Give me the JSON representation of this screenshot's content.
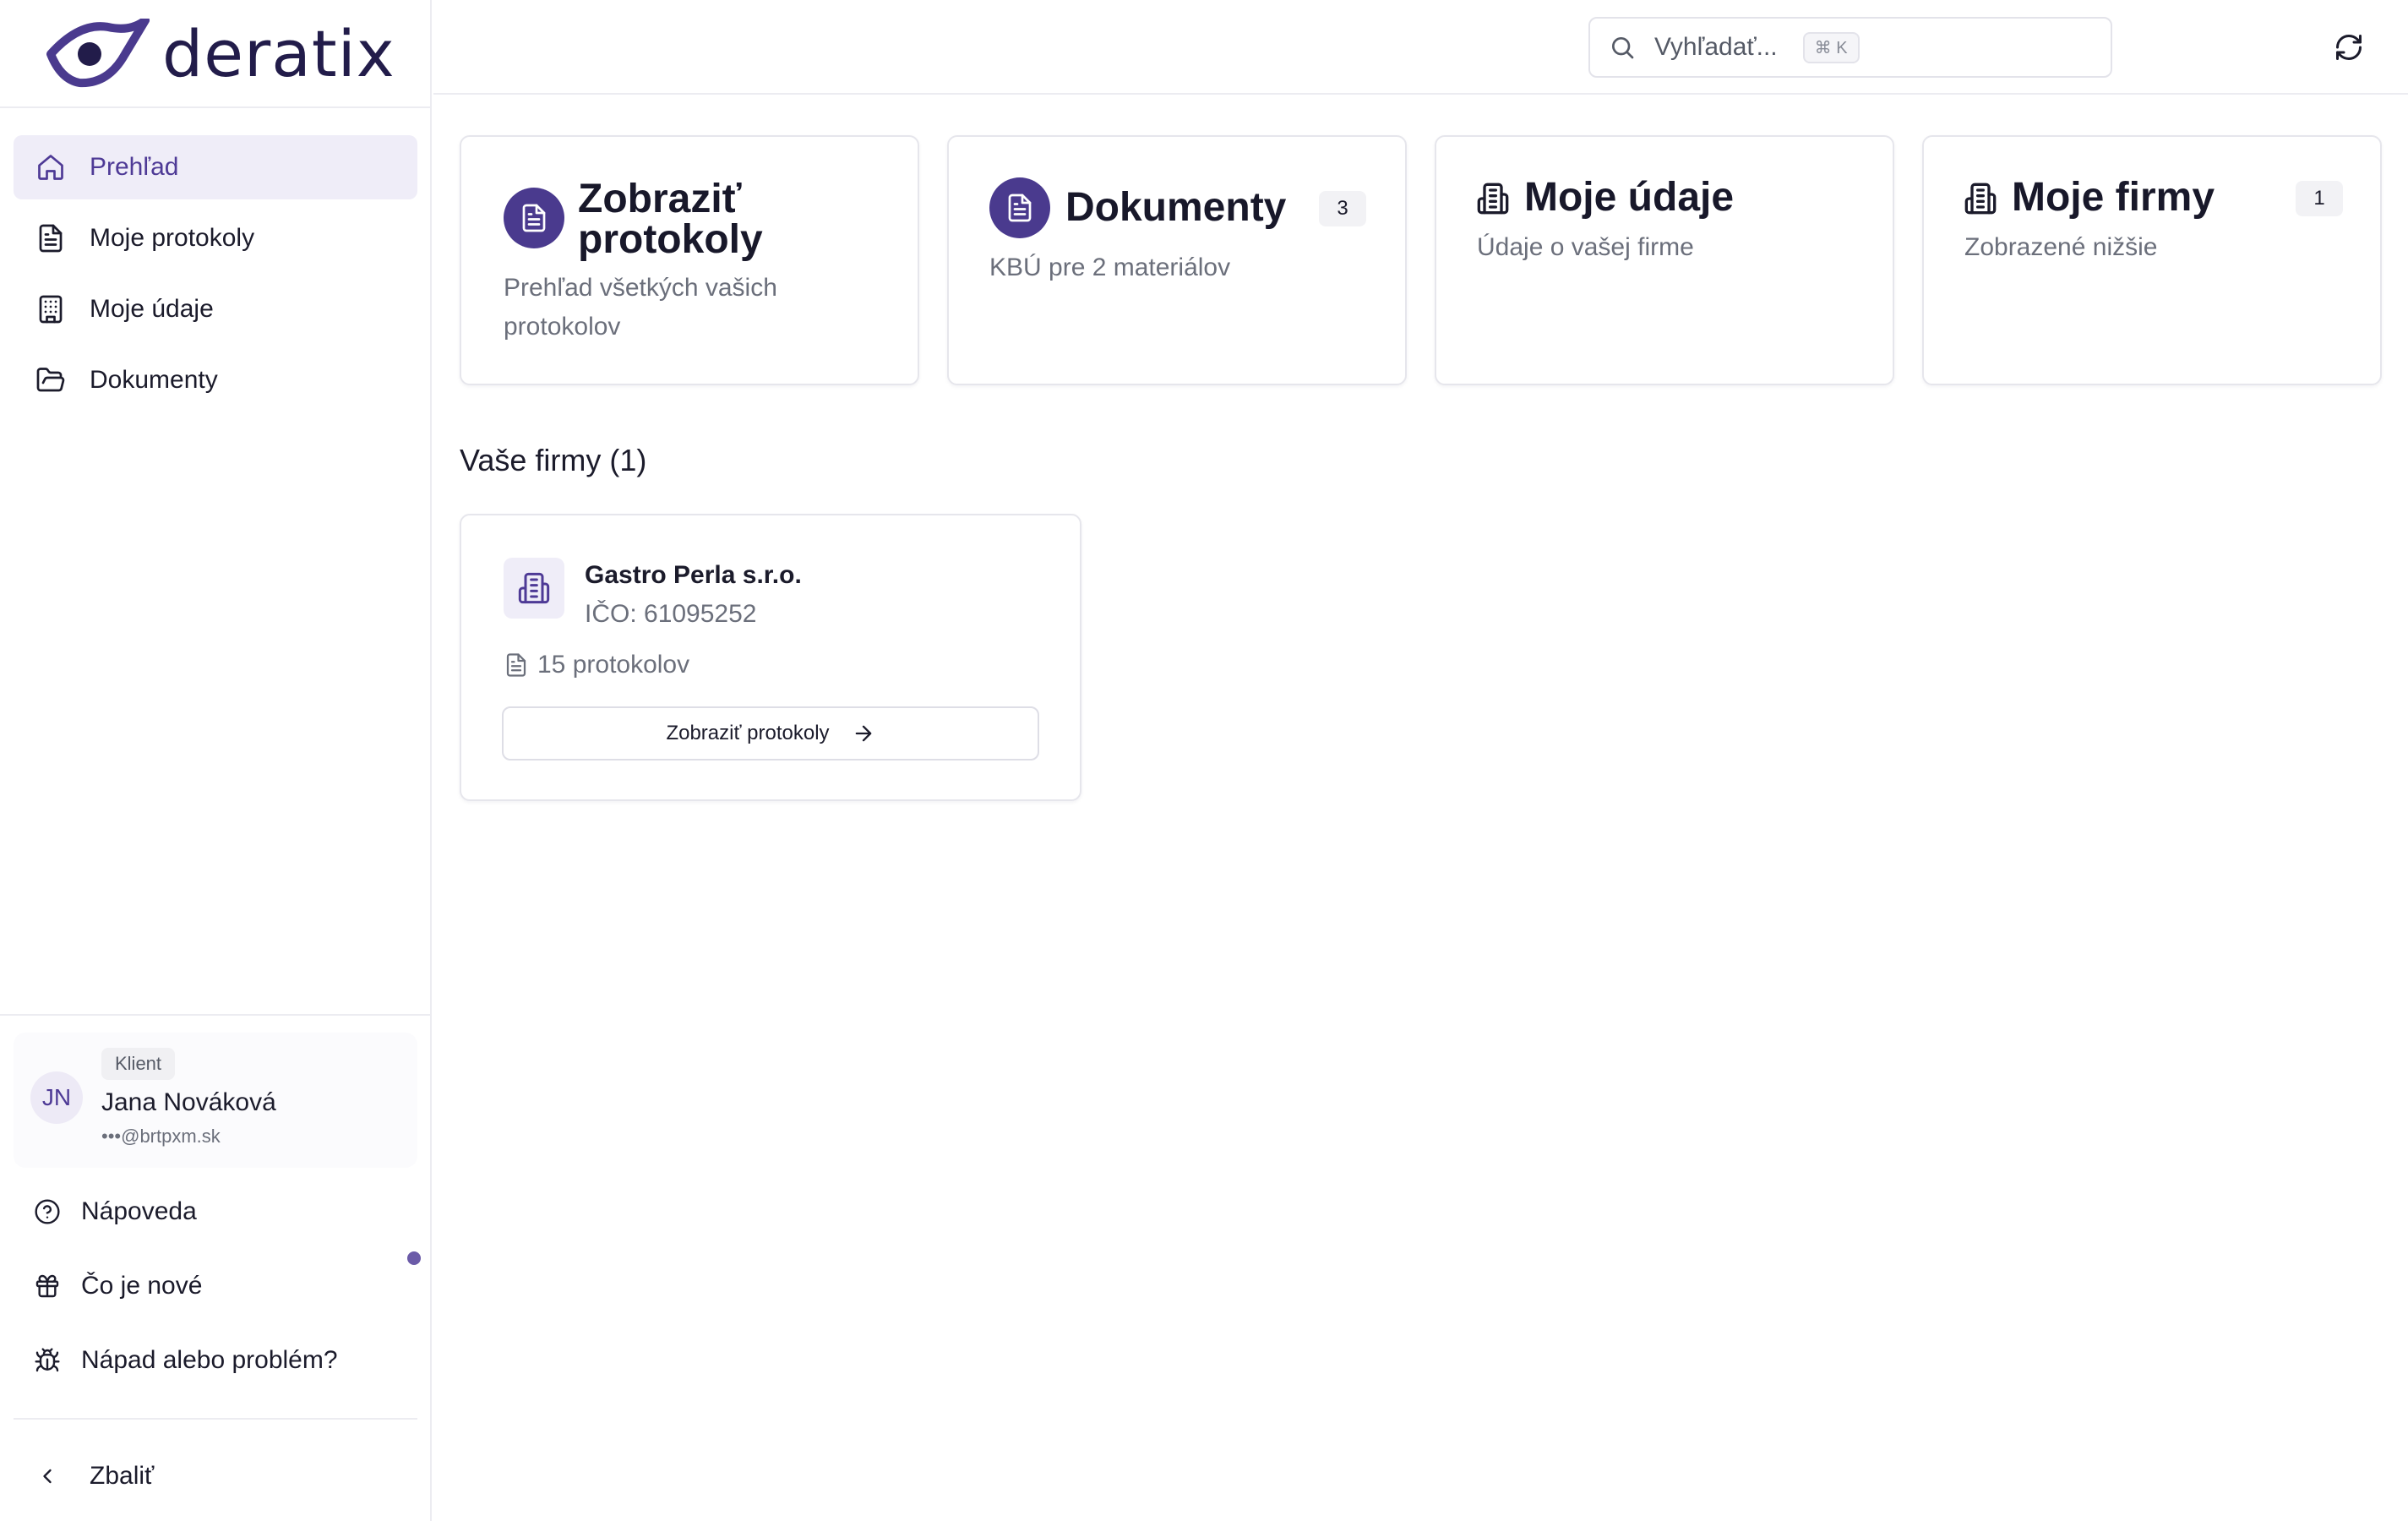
{
  "brand": {
    "name": "deratix",
    "color": "#221c4a",
    "accent": "#4a3a8e"
  },
  "sidebar": {
    "items": [
      {
        "label": "Prehľad",
        "icon": "home-icon",
        "active": true
      },
      {
        "label": "Moje protokoly",
        "icon": "file-text-icon",
        "active": false
      },
      {
        "label": "Moje údaje",
        "icon": "building-icon",
        "active": false
      },
      {
        "label": "Dokumenty",
        "icon": "folder-open-icon",
        "active": false
      }
    ],
    "user": {
      "role": "Klient",
      "initials": "JN",
      "name": "Jana Nováková",
      "email": "•••@brtpxm.sk"
    },
    "utilities": [
      {
        "label": "Nápoveda",
        "icon": "help-circle-icon"
      },
      {
        "label": "Čo je nové",
        "icon": "gift-icon"
      },
      {
        "label": "Nápad alebo problém?",
        "icon": "bug-icon"
      }
    ],
    "collapse_label": "Zbaliť"
  },
  "topbar": {
    "search_placeholder": "Vyhľadať...",
    "shortcut": "⌘ K"
  },
  "cards": [
    {
      "title_line1": "Zobraziť",
      "title_line2": "protokoly",
      "subtitle": "Prehľad všetkých vašich protokolov",
      "icon": "file-text-icon"
    },
    {
      "title": "Dokumenty",
      "subtitle": "KBÚ pre 2 materiálov",
      "count": "3",
      "icon": "file-text-icon"
    },
    {
      "title": "Moje údaje",
      "subtitle": "Údaje o vašej firme",
      "icon": "building-icon"
    },
    {
      "title": "Moje firmy",
      "subtitle": "Zobrazené nižšie",
      "count": "1",
      "icon": "building-icon"
    }
  ],
  "firms_section": {
    "title": "Vaše firmy (1)",
    "firms": [
      {
        "name": "Gastro Perla s.r.o.",
        "ico": "IČO: 61095252",
        "protocols": "15 protokolov",
        "button_label": "Zobraziť protokoly"
      }
    ]
  }
}
